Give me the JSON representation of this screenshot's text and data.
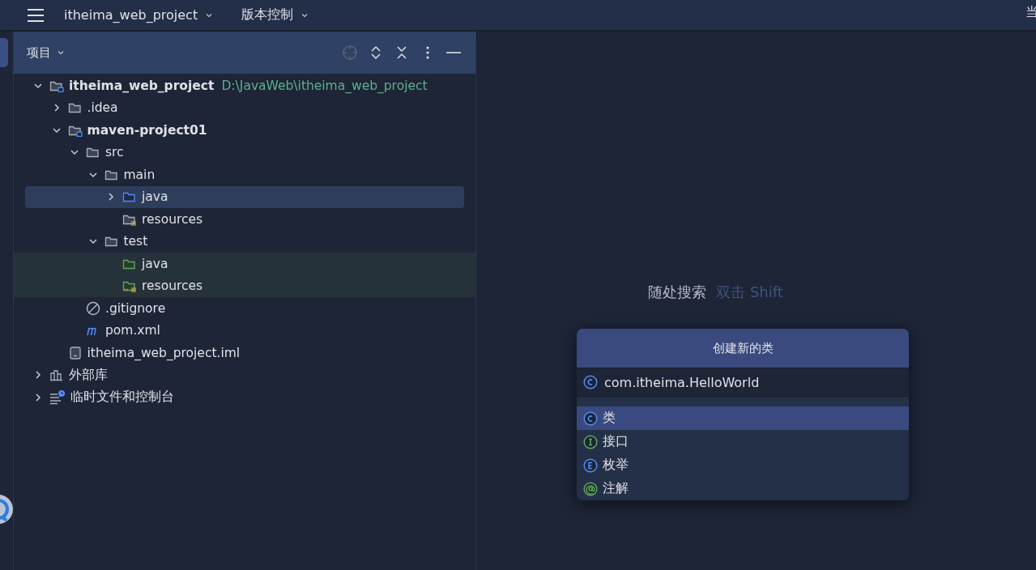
{
  "top_bar": {
    "project": "itheima_web_project",
    "vcs": "版本控制",
    "cut_text": "当"
  },
  "panel": {
    "title": "项目"
  },
  "tree": [
    {
      "name": "itheima_web_project",
      "path": "D:\\JavaWeb\\itheima_web_project",
      "kind": "module",
      "bold": true,
      "expanded": true,
      "selected": false,
      "children": [
        {
          "name": ".idea",
          "kind": "folder",
          "expanded": false,
          "selected": false
        },
        {
          "name": "maven-project01",
          "kind": "module",
          "bold": true,
          "expanded": true,
          "selected": false,
          "children": [
            {
              "name": "src",
              "kind": "folder",
              "expanded": true,
              "selected": false,
              "children": [
                {
                  "name": "main",
                  "kind": "folder",
                  "expanded": true,
                  "selected": false,
                  "children": [
                    {
                      "name": "java",
                      "kind": "source",
                      "expanded": false,
                      "selected": true
                    },
                    {
                      "name": "resources",
                      "kind": "resources",
                      "selected": false
                    }
                  ]
                },
                {
                  "name": "test",
                  "kind": "folder",
                  "expanded": true,
                  "selected": false,
                  "children": [
                    {
                      "name": "java",
                      "kind": "test_source",
                      "selected": false
                    },
                    {
                      "name": "resources",
                      "kind": "test_resources",
                      "selected": false
                    }
                  ]
                }
              ]
            },
            {
              "name": ".gitignore",
              "kind": "ignore",
              "selected": false
            },
            {
              "name": "pom.xml",
              "kind": "maven",
              "selected": false
            }
          ]
        },
        {
          "name": "itheima_web_project.iml",
          "kind": "iml",
          "selected": false
        }
      ]
    },
    {
      "name": "外部库",
      "kind": "library",
      "expanded": false,
      "selected": false
    },
    {
      "name": "临时文件和控制台",
      "kind": "scratch",
      "expanded": false,
      "selected": false
    }
  ],
  "hint": {
    "label": "随处搜索",
    "shortcut": "双击 Shift"
  },
  "dialog": {
    "title": "创建新的类",
    "value": "com.itheima.HelloWorld",
    "items": [
      {
        "label": "类",
        "kind": "class",
        "selected": true
      },
      {
        "label": "接口",
        "kind": "interface",
        "selected": false
      },
      {
        "label": "枚举",
        "kind": "enum",
        "selected": false
      },
      {
        "label": "注解",
        "kind": "annotation",
        "selected": false
      }
    ]
  }
}
